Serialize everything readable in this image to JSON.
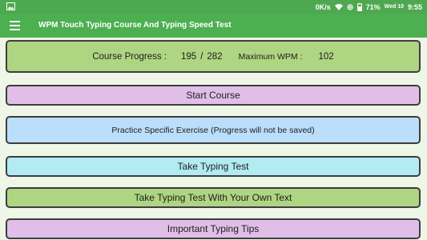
{
  "status_bar": {
    "speed": "0K/s",
    "battery": "71%",
    "date": "Wed 10",
    "time": "9:55"
  },
  "app_bar": {
    "title": "WPM Touch Typing Course And Typing Speed Test"
  },
  "progress": {
    "label": "Course Progress :",
    "completed": "195",
    "separator": "/",
    "total": "282",
    "max_wpm_label": "Maximum WPM :",
    "max_wpm": "102"
  },
  "buttons": {
    "start_course": "Start Course",
    "practice_specific": "Practice Specific Exercise (Progress will not be saved)",
    "take_test": "Take Typing Test",
    "own_text": "Take Typing Test With Your Own Text",
    "tips": "Important Typing Tips"
  },
  "colors": {
    "status_bar": "#4ea84f",
    "app_bar": "#4caf50",
    "progress_panel": "#aed581",
    "start_course": "#e1bee7",
    "practice_specific": "#bbdefb",
    "take_test": "#b2ebf2",
    "own_text": "#aed581",
    "tips": "#e1bee7"
  }
}
